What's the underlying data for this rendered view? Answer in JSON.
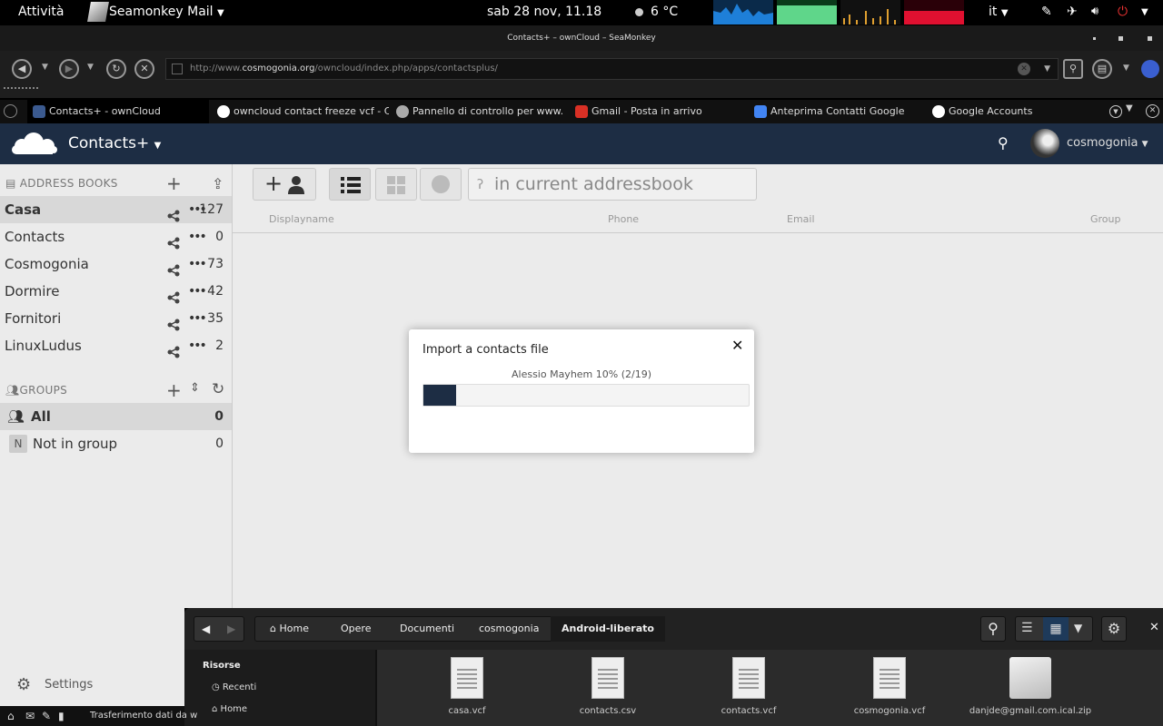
{
  "topbar": {
    "activities": "Attività",
    "app": "Seamonkey Mail",
    "clock": "sab 28 nov, 11.18",
    "weather": "6 °C",
    "lang": "it"
  },
  "window": {
    "title": "Contacts+ – ownCloud – SeaMonkey"
  },
  "urlbar": {
    "prefix": "http://www.",
    "domain": "cosmogonia.org",
    "path": "/owncloud/index.php/apps/contactsplus/"
  },
  "tabs": [
    {
      "label": "Contacts+ - ownCloud",
      "color": "#3b5a8f"
    },
    {
      "label": "owncloud contact freeze vcf - Ce...",
      "color": "#ffffff"
    },
    {
      "label": "Pannello di controllo per www....",
      "color": "#aaaaaa"
    },
    {
      "label": "Gmail - Posta in arrivo",
      "color": "#d93025"
    },
    {
      "label": "Anteprima Contatti Google",
      "color": "#4285f4"
    },
    {
      "label": "Google Accounts",
      "color": "#ffffff"
    }
  ],
  "header": {
    "app_title": "Contacts+",
    "username": "cosmogonia"
  },
  "sidebar": {
    "addressbooks_title": "ADDRESS BOOKS",
    "addressbooks": [
      {
        "name": "Casa",
        "count": "127"
      },
      {
        "name": "Contacts",
        "count": "0"
      },
      {
        "name": "Cosmogonia",
        "count": "73"
      },
      {
        "name": "Dormire",
        "count": "42"
      },
      {
        "name": "Fornitori",
        "count": "35"
      },
      {
        "name": "LinuxLudus",
        "count": "2"
      }
    ],
    "groups_title": "GROUPS",
    "groups": [
      {
        "name": "All",
        "count": "0"
      },
      {
        "name": "Not in group",
        "count": "0",
        "badge": "N"
      }
    ],
    "settings": "Settings"
  },
  "toolbar": {
    "search_placeholder": "in current addressbook"
  },
  "columns": {
    "name": "Displayname",
    "phone": "Phone",
    "email": "Email",
    "group": "Group"
  },
  "modal": {
    "title": "Import a contacts file",
    "status": "Alessio Mayhem 10% (2/19)",
    "progress_fraction": 0.1,
    "progress_color": "#1d2d44"
  },
  "files": {
    "breadcrumbs": [
      "Home",
      "Opere",
      "Documenti",
      "cosmogonia",
      "Android-liberato"
    ],
    "sidebar_title": "Risorse",
    "places": [
      "Recenti",
      "Home"
    ],
    "items": [
      "casa.vcf",
      "contacts.csv",
      "contacts.vcf",
      "cosmogonia.vcf",
      "danjde@gmail.com.ical.zip"
    ]
  },
  "status": {
    "text": "Trasferimento dati da w"
  }
}
